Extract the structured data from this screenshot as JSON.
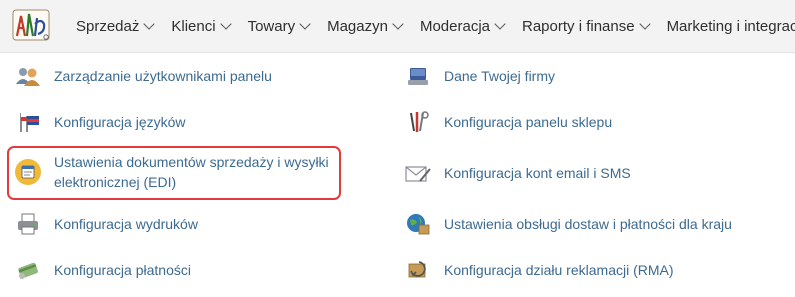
{
  "logo_icon": "app-logo-icon",
  "menu": [
    {
      "label": "Sprzedaż"
    },
    {
      "label": "Klienci"
    },
    {
      "label": "Towary"
    },
    {
      "label": "Magazyn"
    },
    {
      "label": "Moderacja"
    },
    {
      "label": "Raporty i finanse"
    },
    {
      "label": "Marketing i integracje"
    }
  ],
  "left_items": [
    {
      "label": "Zarządzanie użytkownikami panelu",
      "icon": "users-icon"
    },
    {
      "label": "Konfiguracja języków",
      "icon": "flags-icon"
    },
    {
      "label_line1": "Ustawienia dokumentów sprzedaży i wysyłki",
      "label_line2": "elektronicznej (EDI)",
      "icon": "documents-icon"
    },
    {
      "label": "Konfiguracja wydruków",
      "icon": "printer-icon"
    },
    {
      "label": "Konfiguracja płatności",
      "icon": "payment-icon"
    }
  ],
  "right_items": [
    {
      "label": "Dane Twojej firmy",
      "icon": "company-icon"
    },
    {
      "label": "Konfiguracja panelu sklepu",
      "icon": "tools-icon"
    },
    {
      "label": "Konfiguracja kont email i SMS",
      "icon": "email-icon"
    },
    {
      "label": "Ustawienia obsługi dostaw i płatności dla kraju",
      "icon": "globe-box-icon"
    },
    {
      "label": "Konfiguracja działu reklamacji (RMA)",
      "icon": "rma-icon"
    }
  ],
  "highlight_color": "#e23b3b",
  "link_color": "#3c6a91"
}
